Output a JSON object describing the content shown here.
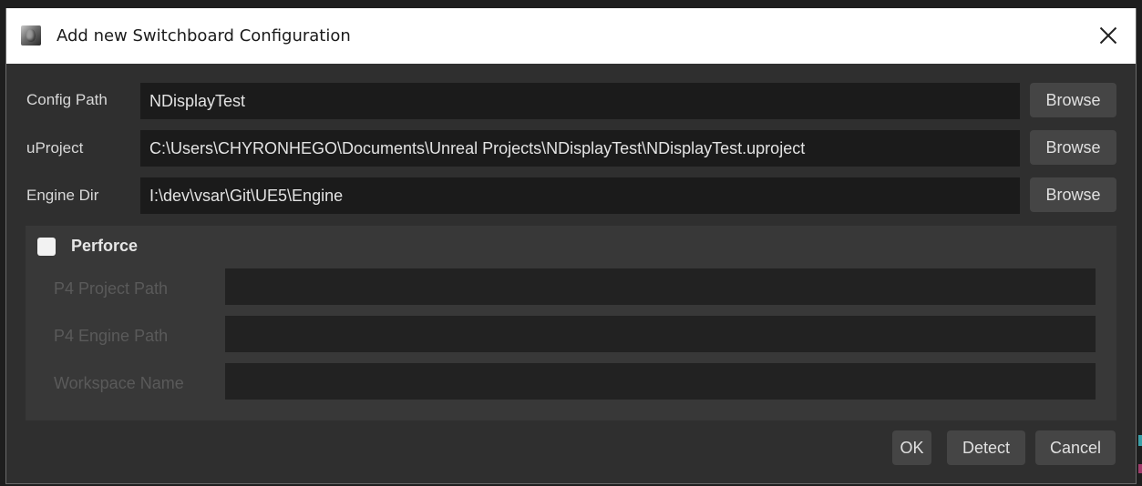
{
  "window": {
    "title": "Add new Switchboard Configuration"
  },
  "form": {
    "config_path": {
      "label": "Config Path",
      "value": "NDisplayTest",
      "browse_label": "Browse"
    },
    "uproject": {
      "label": "uProject",
      "value": "C:\\Users\\CHYRONHEGO\\Documents\\Unreal Projects\\NDisplayTest\\NDisplayTest.uproject",
      "browse_label": "Browse"
    },
    "engine_dir": {
      "label": "Engine Dir",
      "value": "I:\\dev\\vsar\\Git\\UE5\\Engine",
      "browse_label": "Browse"
    }
  },
  "perforce": {
    "label": "Perforce",
    "checked": false,
    "p4_project_path_label": "P4 Project Path",
    "p4_engine_path_label": "P4 Engine Path",
    "workspace_name_label": "Workspace Name"
  },
  "footer": {
    "ok_label": "OK",
    "detect_label": "Detect",
    "cancel_label": "Cancel"
  }
}
